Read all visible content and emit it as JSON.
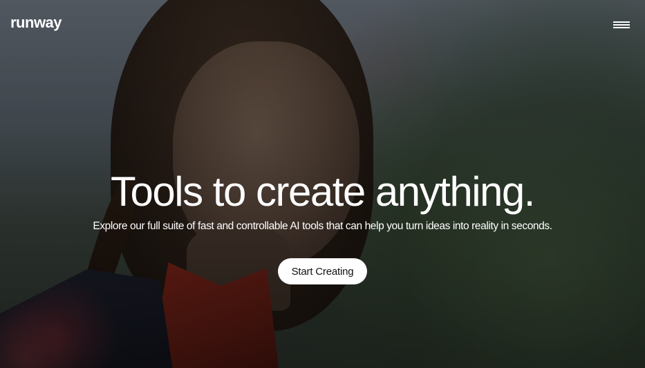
{
  "header": {
    "logo_text": "runway",
    "menu_icon": "hamburger-menu-icon"
  },
  "hero": {
    "headline": "Tools to create anything.",
    "subheadline": "Explore our full suite of fast and controllable AI tools that can help you turn ideas into reality in seconds.",
    "cta_label": "Start Creating"
  },
  "colors": {
    "text": "#ffffff",
    "button_bg": "#ffffff",
    "button_text": "#111111"
  }
}
